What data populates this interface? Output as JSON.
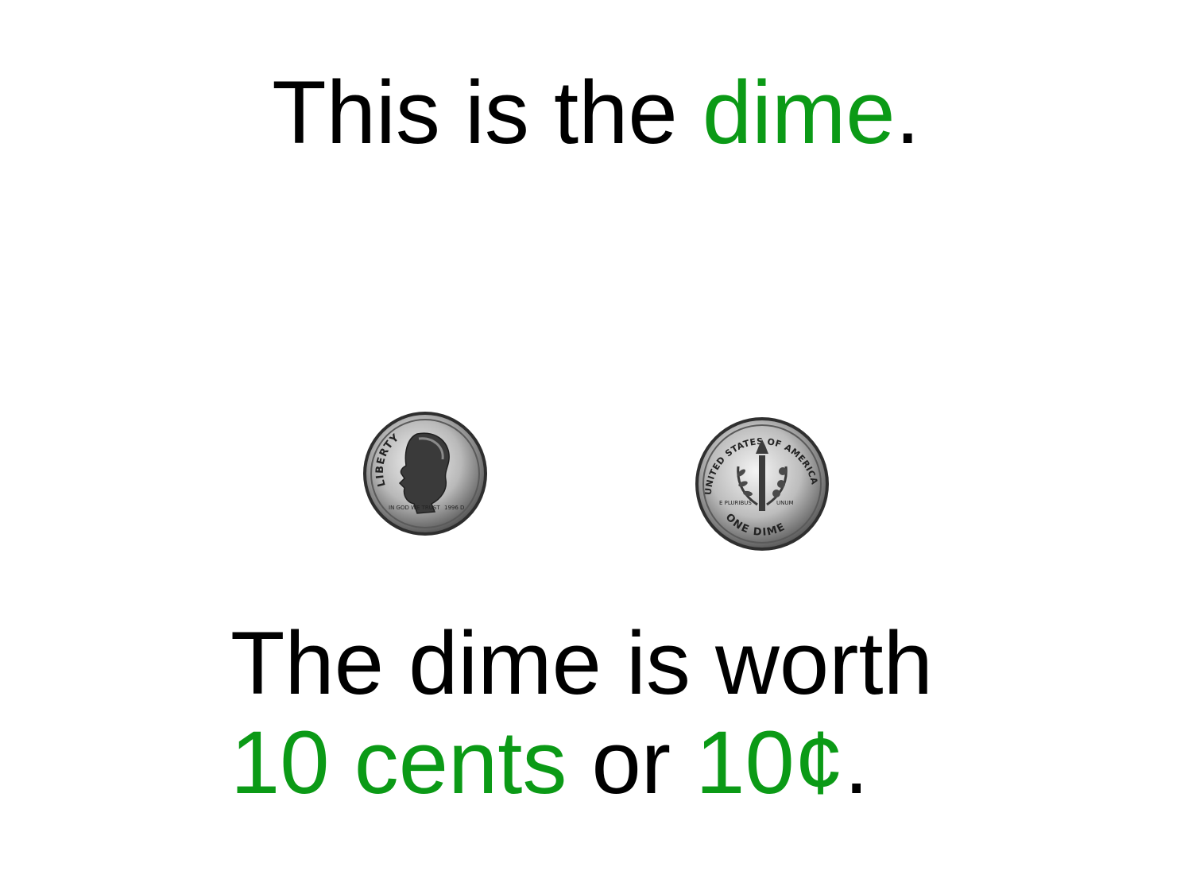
{
  "title": {
    "prefix": "This is the ",
    "highlight": "dime",
    "suffix": "."
  },
  "coins": {
    "front": {
      "icon": "dime-obverse-icon",
      "inscription_top": "LIBERTY",
      "inscription_left": "IN GOD WE TRUST",
      "inscription_right": "1996 D"
    },
    "back": {
      "icon": "dime-reverse-icon",
      "inscription_top": "UNITED STATES OF AMERICA",
      "inscription_mid_left": "E PLURIBUS",
      "inscription_mid_right": "UNUM",
      "inscription_bottom": "ONE DIME"
    }
  },
  "worth": {
    "line1": "The dime is worth",
    "amount_words": "10 cents",
    "connector": " or ",
    "amount_symbol": "10¢",
    "end": "."
  },
  "colors": {
    "highlight": "#0b9a16",
    "text": "#000000",
    "background": "#ffffff"
  }
}
